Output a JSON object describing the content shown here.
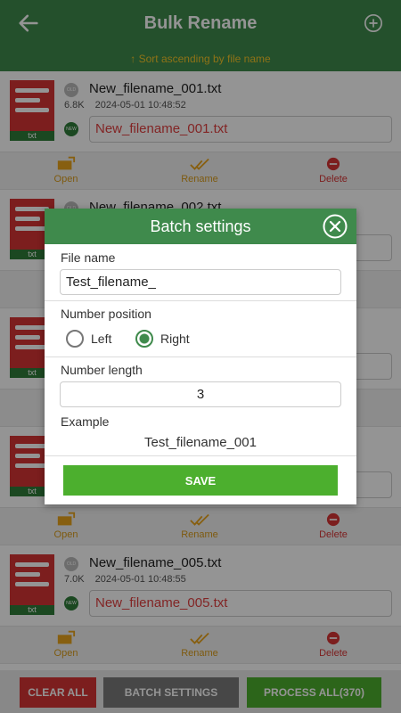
{
  "header": {
    "title": "Bulk Rename",
    "sort_hint": "↑ Sort ascending by file name"
  },
  "colors": {
    "primary": "#3f8a4c",
    "accent": "#f3c428",
    "danger": "#d63434",
    "success": "#4caf2e"
  },
  "file_actions": {
    "open": "Open",
    "rename": "Rename",
    "delete": "Delete"
  },
  "files": [
    {
      "ext": "txt",
      "name": "New_filename_001.txt",
      "size": "6.8K",
      "date": "2024-05-01 10:48:52",
      "new_name": "New_filename_001.txt"
    },
    {
      "ext": "txt",
      "name": "New_filename_002.txt"
    },
    {
      "ext": "txt"
    },
    {
      "ext": "txt"
    },
    {
      "ext": "txt",
      "name": "New_filename_005.txt",
      "size": "7.0K",
      "date": "2024-05-01 10:48:55",
      "new_name": "New_filename_005.txt"
    }
  ],
  "footer": {
    "clear_all": "CLEAR ALL",
    "batch_settings": "BATCH SETTINGS",
    "process_all": "PROCESS ALL(370)"
  },
  "dialog": {
    "title": "Batch settings",
    "file_name_label": "File name",
    "file_name_value": "Test_filename_",
    "number_position_label": "Number position",
    "position_options": [
      "Left",
      "Right"
    ],
    "position_selected": "Right",
    "number_length_label": "Number length",
    "number_length_value": "3",
    "example_label": "Example",
    "example_value": "Test_filename_001",
    "save_label": "SAVE"
  }
}
